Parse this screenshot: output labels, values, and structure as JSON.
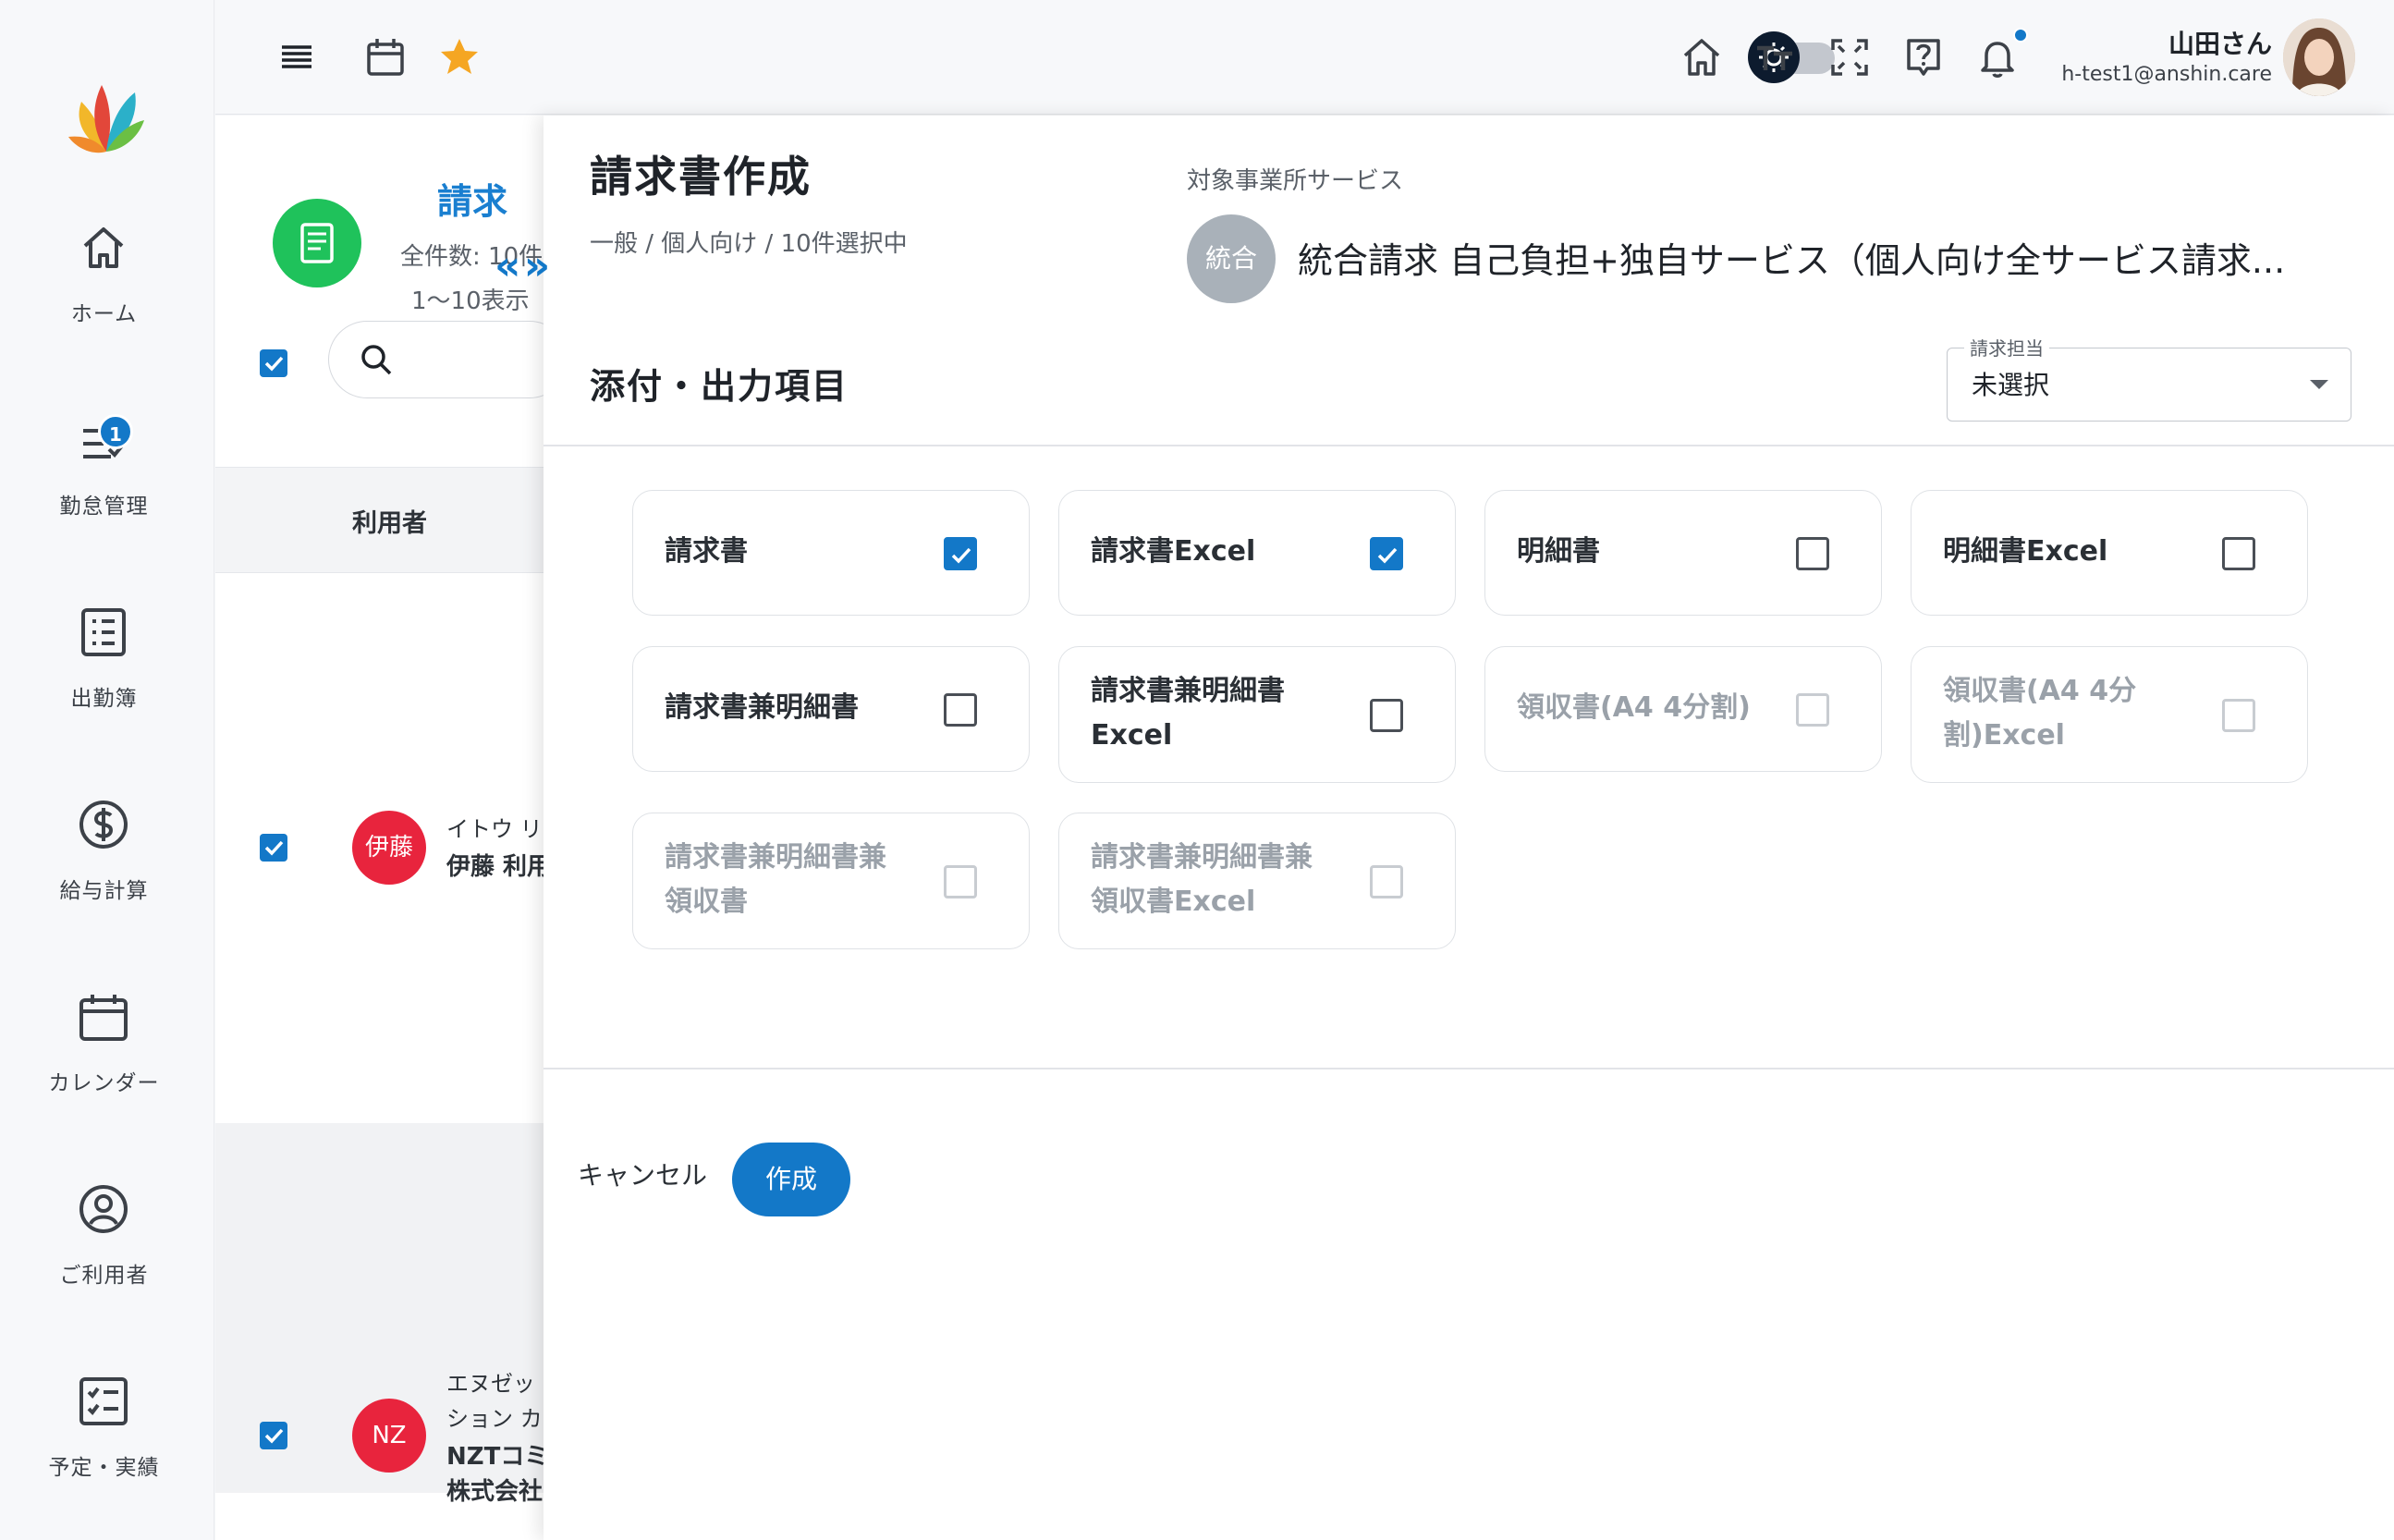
{
  "sidebar": {
    "items": [
      {
        "label": "ホーム",
        "icon": "home-icon"
      },
      {
        "label": "勤怠管理",
        "icon": "attendance-icon",
        "badge": "1"
      },
      {
        "label": "出勤簿",
        "icon": "list-icon"
      },
      {
        "label": "給与計算",
        "icon": "dollar-icon"
      },
      {
        "label": "カレンダー",
        "icon": "calendar-icon"
      },
      {
        "label": "ご利用者",
        "icon": "user-icon"
      },
      {
        "label": "予定・実績",
        "icon": "checklist-icon"
      }
    ]
  },
  "header": {
    "user_name": "山田さん",
    "user_email": "h-test1@anshin.care",
    "accent": "#1378c8"
  },
  "background_page": {
    "title": "請求",
    "count": "全件数: 10件",
    "range": "1〜10表示",
    "column_header": "利用者",
    "rows": [
      {
        "avatar": "伊藤",
        "kana": "イトウ リ",
        "name": "伊藤 利用"
      },
      {
        "avatar": "NZ",
        "kana_1": "エヌゼッ",
        "kana_2": "ション カ",
        "name_1": "NZTコミ",
        "name_2": "株式会社"
      }
    ]
  },
  "panel": {
    "title": "請求書作成",
    "subtitle": "一般 / 個人向け / 10件選択中",
    "service_label": "対象事業所サービス",
    "service_badge": "統合",
    "service_name": "統合請求 自己負担+独自サービス（個人向け全サービス請求...",
    "section_title": "添付・出力項目",
    "assignee": {
      "legend": "請求担当",
      "value": "未選択"
    },
    "options": [
      {
        "label": "請求書",
        "checked": true,
        "disabled": false
      },
      {
        "label": "請求書Excel",
        "checked": true,
        "disabled": false
      },
      {
        "label": "明細書",
        "checked": false,
        "disabled": false
      },
      {
        "label": "明細書Excel",
        "checked": false,
        "disabled": false
      },
      {
        "label": "請求書兼明細書",
        "checked": false,
        "disabled": false
      },
      {
        "label_1": "請求書兼明細書",
        "label_2": "Excel",
        "checked": false,
        "disabled": false
      },
      {
        "label": "領収書(A4 4分割)",
        "checked": false,
        "disabled": true
      },
      {
        "label_1": "領収書(A4 4分",
        "label_2": "割)Excel",
        "checked": false,
        "disabled": true
      },
      {
        "label_1": "請求書兼明細書兼",
        "label_2": "領収書",
        "checked": false,
        "disabled": true
      },
      {
        "label_1": "請求書兼明細書兼",
        "label_2": "領収書Excel",
        "checked": false,
        "disabled": true
      }
    ],
    "cancel_label": "キャンセル",
    "create_label": "作成"
  }
}
